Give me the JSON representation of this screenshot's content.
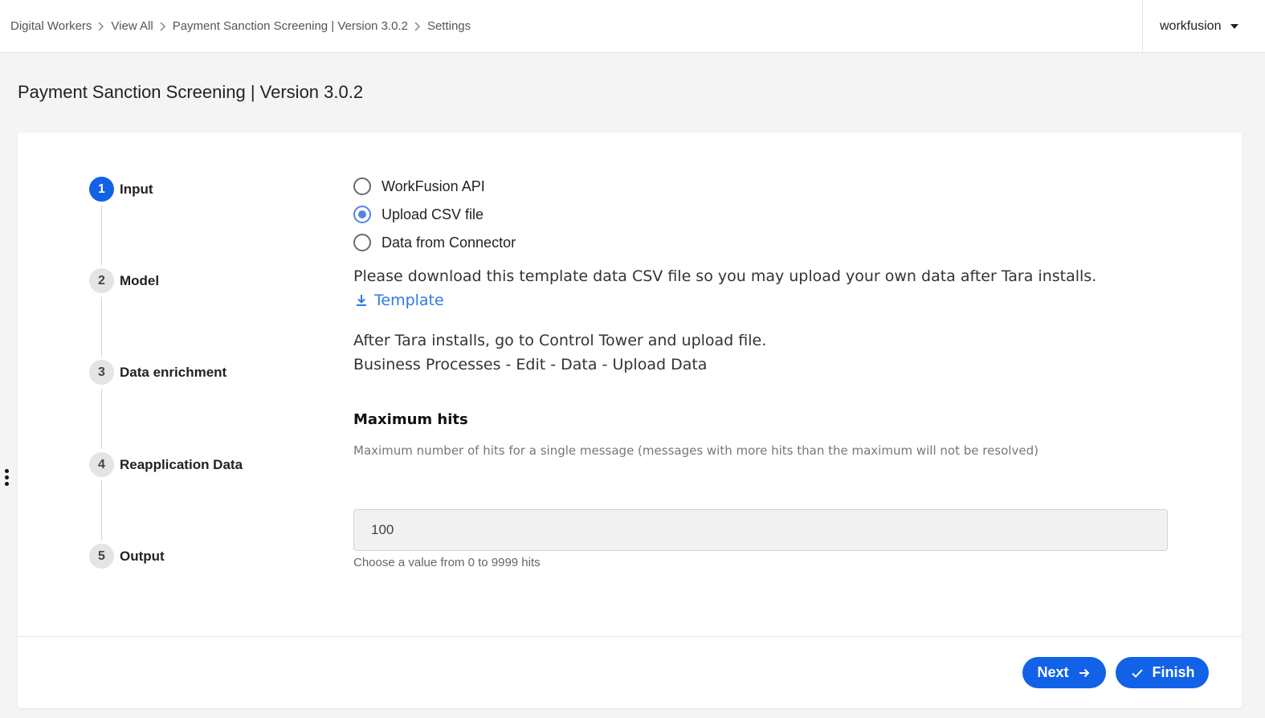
{
  "breadcrumb": {
    "items": [
      "Digital Workers",
      "View All",
      "Payment Sanction Screening | Version 3.0.2",
      "Settings"
    ]
  },
  "user_menu": {
    "label": "workfusion"
  },
  "page": {
    "title": "Payment Sanction Screening | Version 3.0.2"
  },
  "steps": [
    {
      "number": "1",
      "label": "Input",
      "active": true
    },
    {
      "number": "2",
      "label": "Model",
      "active": false
    },
    {
      "number": "3",
      "label": "Data enrichment",
      "active": false
    },
    {
      "number": "4",
      "label": "Reapplication Data",
      "active": false
    },
    {
      "number": "5",
      "label": "Output",
      "active": false
    }
  ],
  "input_options": [
    {
      "label": "WorkFusion API",
      "checked": false
    },
    {
      "label": "Upload CSV file",
      "checked": true
    },
    {
      "label": "Data from Connector",
      "checked": false
    }
  ],
  "info": {
    "download_text": "Please download this template data CSV file so you may upload your own data after Tara installs.",
    "template_link": "Template",
    "after_text_1": "After Tara installs, go to Control Tower and upload file.",
    "after_text_2": "Business Processes - Edit - Data - Upload Data"
  },
  "max_hits": {
    "title": "Maximum hits",
    "description": "Maximum number of hits for a single message (messages with more hits than the maximum will not be resolved)",
    "value": "100",
    "hint": "Choose a value from 0 to 9999 hits"
  },
  "footer": {
    "next_label": "Next",
    "finish_label": "Finish"
  },
  "colors": {
    "accent": "#1262e8",
    "radio_checked": "#4f86e0",
    "link": "#2f7ae5"
  }
}
